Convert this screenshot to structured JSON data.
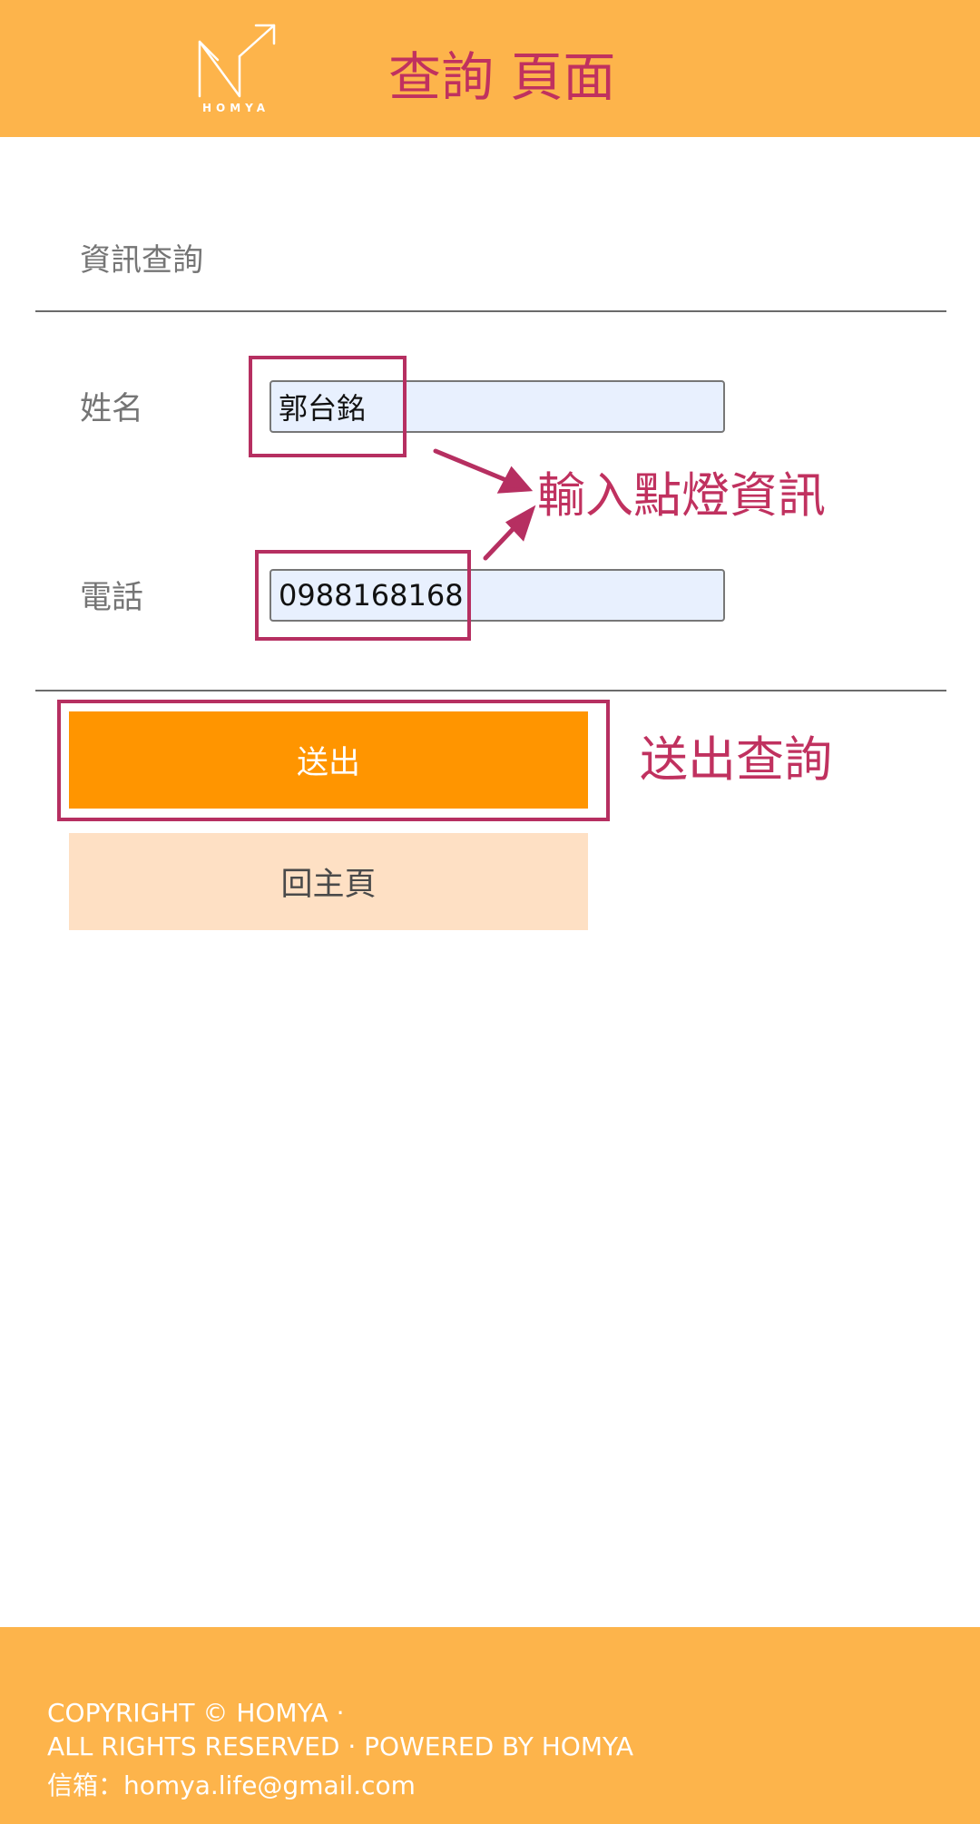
{
  "header": {
    "logo_text": "HOMYA",
    "title": "查詢 頁面"
  },
  "form": {
    "section_title": "資訊查詢",
    "name_label": "姓名",
    "name_value": "郭台銘",
    "phone_label": "電話",
    "phone_value": "0988168168"
  },
  "buttons": {
    "submit_label": "送出",
    "home_label": "回主頁"
  },
  "annotations": {
    "input_note": "輸入點燈資訊",
    "submit_note": "送出查詢",
    "color": "#b62f61"
  },
  "footer": {
    "line1": "COPYRIGHT © HOMYA ·",
    "line2": "ALL RIGHTS RESERVED · POWERED BY HOMYA",
    "line3": "信箱：homya.life@gmail.com"
  },
  "colors": {
    "header_bg": "#fdb44b",
    "title": "#c0315f",
    "submit_bg": "#ff9500",
    "home_bg": "#fee0c4",
    "input_bg": "#e8f0fe"
  }
}
